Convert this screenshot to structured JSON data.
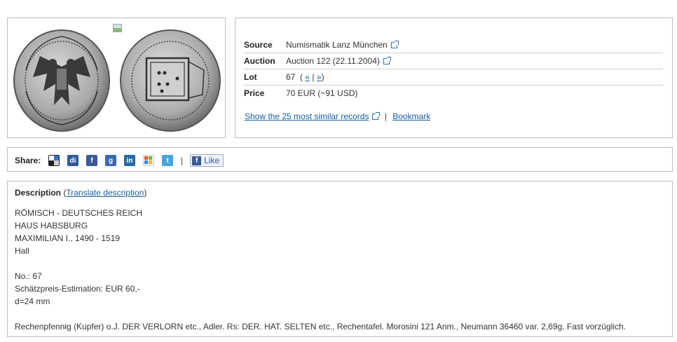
{
  "info": {
    "rows": [
      {
        "label": "Source",
        "value": "Numismatik Lanz München",
        "external": true
      },
      {
        "label": "Auction",
        "value": "Auction 122 (22.11.2004)",
        "external": true
      },
      {
        "label": "Lot",
        "value": "67",
        "prev": "«",
        "next": "»",
        "divider": "|"
      },
      {
        "label": "Price",
        "value": "70 EUR (~91 USD)"
      }
    ],
    "similar_link": "Show the 25 most similar records",
    "bookmark_link": "Bookmark",
    "divider": "|"
  },
  "share": {
    "label": "Share:",
    "icons": [
      "delicious-icon",
      "digg-icon",
      "facebook-icon",
      "google-icon",
      "linkedin-icon",
      "windows-live-icon",
      "twitter-icon"
    ],
    "divider": "|",
    "like_label": "Like"
  },
  "description": {
    "heading": "Description",
    "translate_link": "Translate description",
    "lines": [
      "RÖMISCH - DEUTSCHES REICH",
      "HAUS HABSBURG",
      "MAXIMILIAN I., 1490 - 1519",
      "Hall",
      "",
      "No.: 67",
      "Schätzpreis-Estimation: EUR 60,-",
      "d=24 mm",
      "",
      "Rechenpfennig (Kupfer) o.J. DER VERLORN etc., Adler. Rs: DER. HAT. SELTEN etc., Rechentafel. Morosini 121 Anm., Neumann 36460 var. 2,69g. Fast vorzüglich."
    ]
  },
  "colors": {
    "link": "#1a5e9c",
    "border": "#bdbdbd"
  }
}
